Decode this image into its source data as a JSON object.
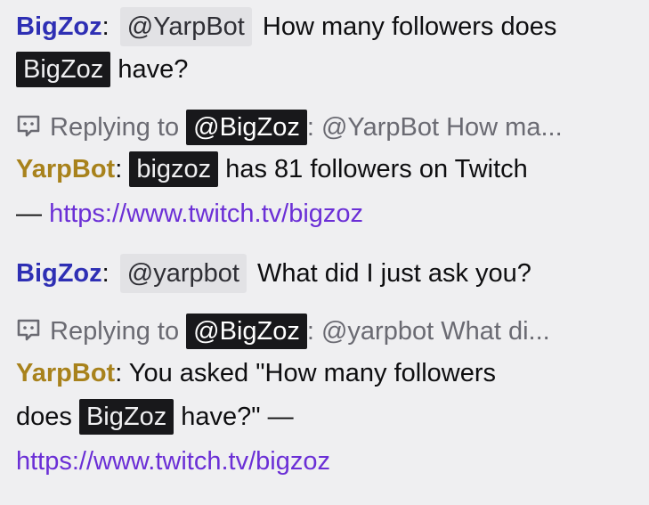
{
  "messages": [
    {
      "user": "BigZoz",
      "mention": "@YarpBot",
      "text_before": "How many followers does",
      "highlight": "BigZoz",
      "text_after": "have?"
    },
    {
      "reply_prefix": "Replying to",
      "reply_target": "@BigZoz",
      "reply_excerpt": ": @YarpBot How ma...",
      "user": "YarpBot",
      "highlight": "bigzoz",
      "text_after": "has 81 followers on Twitch",
      "dash": "—",
      "link": "https://www.twitch.tv/bigzoz"
    },
    {
      "user": "BigZoz",
      "mention": "@yarpbot",
      "text": "What did I just ask you?"
    },
    {
      "reply_prefix": "Replying to",
      "reply_target": "@BigZoz",
      "reply_excerpt": ": @yarpbot What di...",
      "user": "YarpBot",
      "text_before": "You asked \"How many followers",
      "text_line2_before": "does",
      "highlight": "BigZoz",
      "text_line2_after": "have?\" —",
      "link": "https://www.twitch.tv/bigzoz"
    }
  ],
  "colors": {
    "bigzoz": "#2e2fb4",
    "yarpbot": "#a8821c",
    "link": "#6b2fd6",
    "background": "#efeff1"
  },
  "icons": {
    "reply": "chat-bubble-icon"
  }
}
